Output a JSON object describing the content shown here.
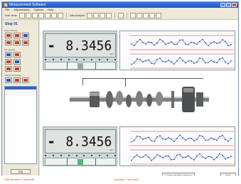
{
  "window": {
    "title": "Measurement Software"
  },
  "menu": [
    "File",
    "Adjustments",
    "Options",
    "Help"
  ],
  "toolbar": {
    "group1_label": "Tools Mode",
    "group2_label": "Data Analysis"
  },
  "left_panel": {
    "step": "Step 01",
    "section1": "Select Display",
    "section2": "Set Display",
    "section3": "Additional Display",
    "bottom_button": "Exit"
  },
  "readouts": [
    {
      "sign": "-",
      "value": "8.3456",
      "unit": "mm",
      "fill_color": "#9ea4a6",
      "level": 0.5
    },
    {
      "sign": "-",
      "value": "8.3456",
      "unit": "mm",
      "fill_color": "#55b877",
      "level": 0.5
    }
  ],
  "buttons": {
    "save_results": "Create results summary",
    "next": "Next"
  },
  "status": {
    "left": "Part Number: Camshaft",
    "middle": "Operator: Tool User",
    "right": ""
  }
}
